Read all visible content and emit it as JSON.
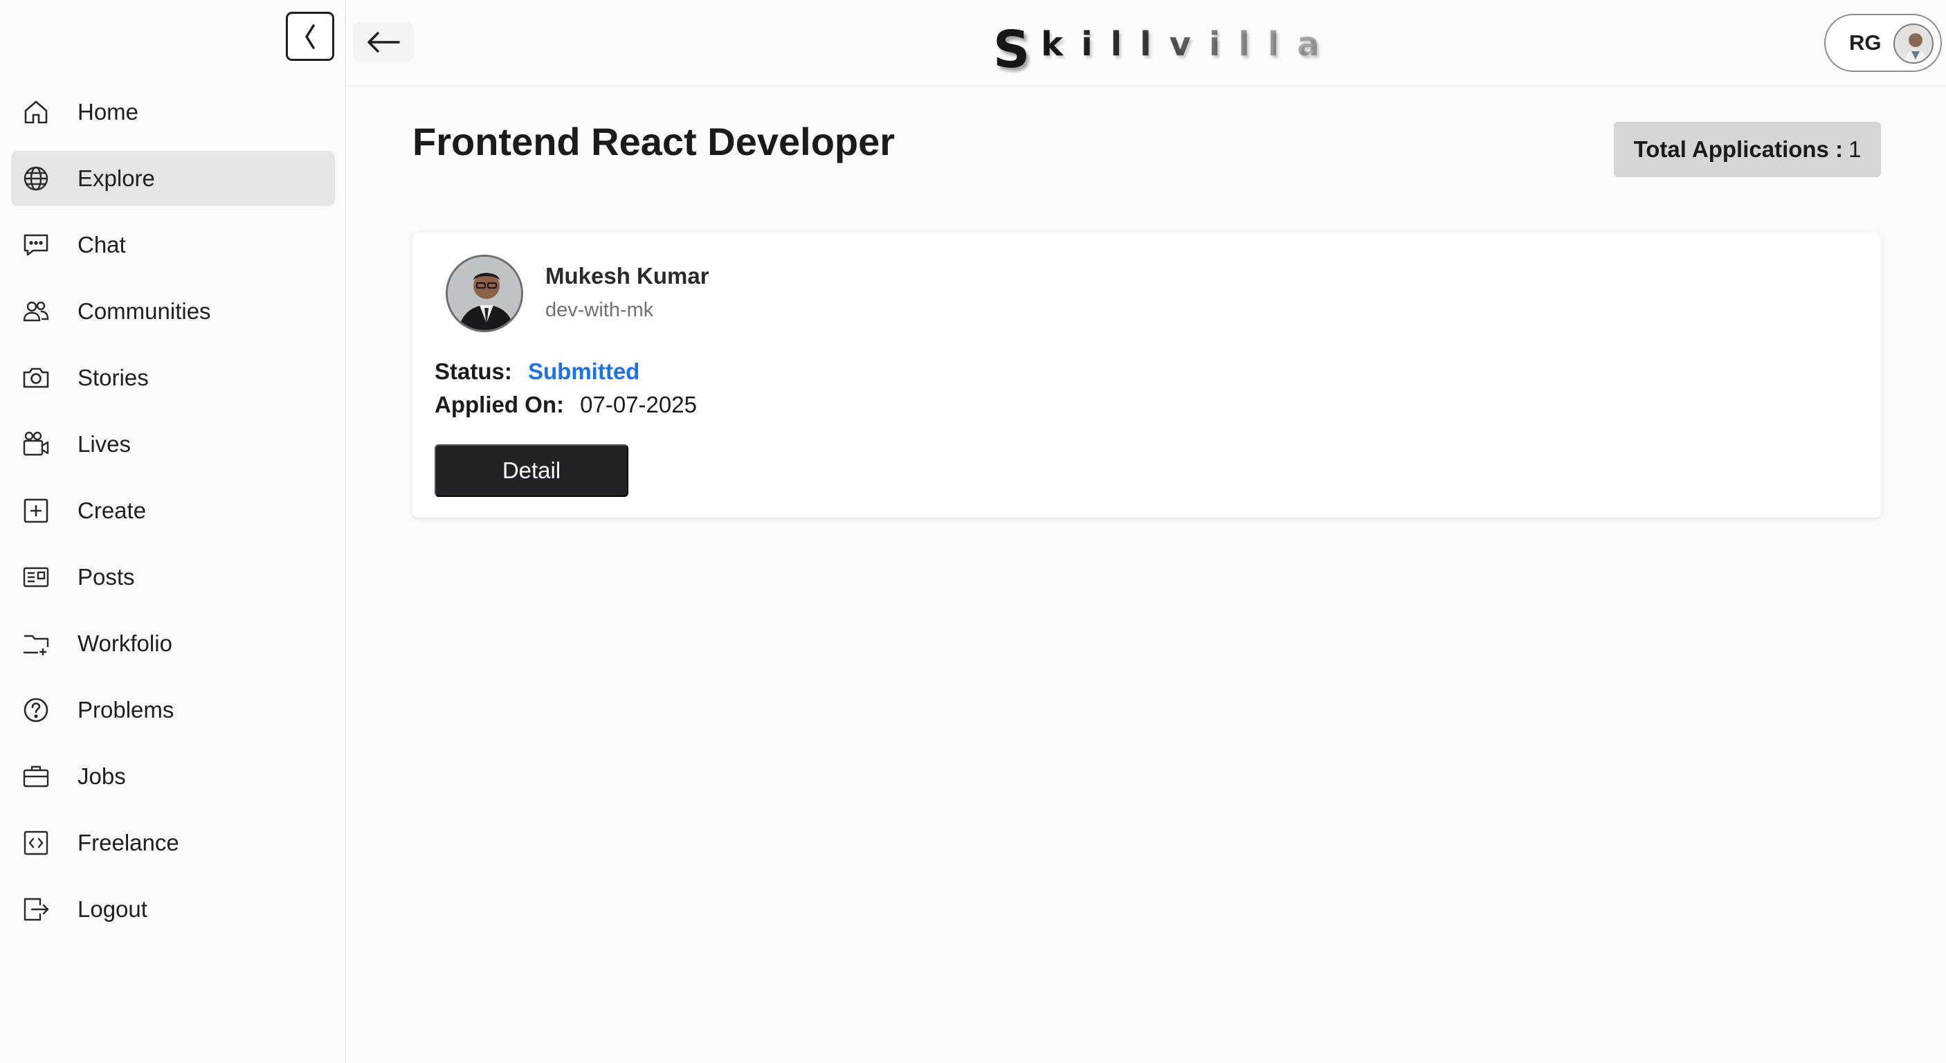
{
  "brand": {
    "first_letter": "S",
    "rest": "killvilla"
  },
  "sidebar": {
    "items": [
      {
        "label": "Home",
        "icon": "home-icon"
      },
      {
        "label": "Explore",
        "icon": "globe-icon",
        "active": true
      },
      {
        "label": "Chat",
        "icon": "chat-icon"
      },
      {
        "label": "Communities",
        "icon": "users-icon"
      },
      {
        "label": "Stories",
        "icon": "camera-icon"
      },
      {
        "label": "Lives",
        "icon": "video-camera-icon"
      },
      {
        "label": "Create",
        "icon": "plus-square-icon"
      },
      {
        "label": "Posts",
        "icon": "newspaper-icon"
      },
      {
        "label": "Workfolio",
        "icon": "folder-plus-icon"
      },
      {
        "label": "Problems",
        "icon": "question-circle-icon"
      },
      {
        "label": "Jobs",
        "icon": "briefcase-icon"
      },
      {
        "label": "Freelance",
        "icon": "code-square-icon"
      },
      {
        "label": "Logout",
        "icon": "logout-icon"
      }
    ]
  },
  "header": {
    "user_initials": "RG"
  },
  "page": {
    "title": "Frontend React Developer",
    "total_label": "Total Applications :",
    "total_count": "1"
  },
  "application": {
    "name": "Mukesh Kumar",
    "handle": "dev-with-mk",
    "status_label": "Status:",
    "status_value": "Submitted",
    "applied_label": "Applied On:",
    "applied_value": "07-07-2025",
    "detail_label": "Detail"
  },
  "colors": {
    "status_blue": "#1a73e8",
    "active_nav_bg": "#e6e5e4",
    "button_dark": "#212326",
    "total_badge_bg": "#d6d6d6"
  }
}
